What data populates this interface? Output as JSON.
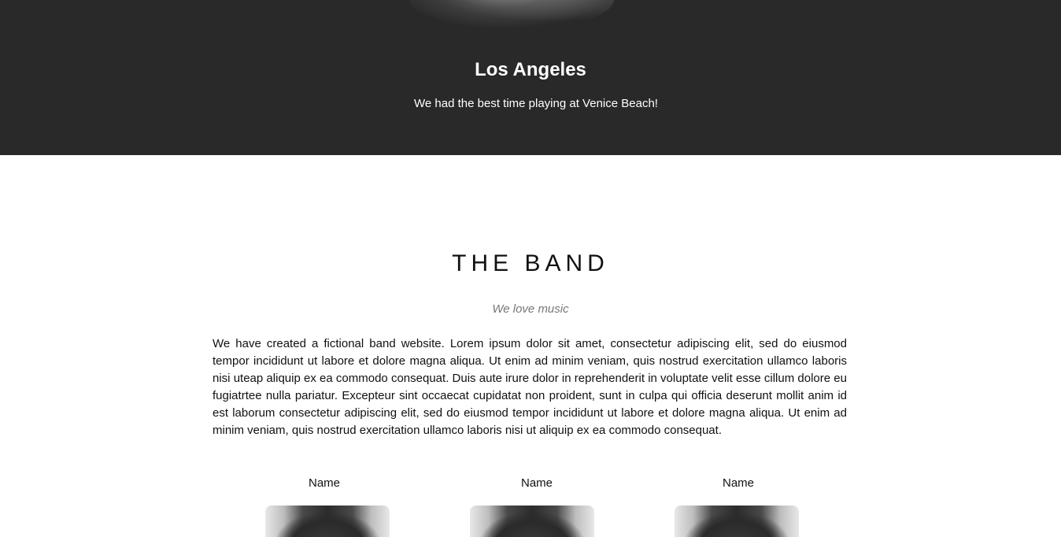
{
  "hero": {
    "title": "Los Angeles",
    "caption": "We had the best time playing at Venice Beach!"
  },
  "band": {
    "title": "THE BAND",
    "subtitle": "We love music",
    "body": "We have created a fictional band website. Lorem ipsum dolor sit amet, consectetur adipiscing elit, sed do eiusmod tempor incididunt ut labore et dolore magna aliqua. Ut enim ad minim veniam, quis nostrud exercitation ullamco laboris nisi uteap aliquip ex ea commodo consequat. Duis aute irure dolor in reprehenderit in voluptate velit esse cillum dolore eu fugiatrtee nulla pariatur. Excepteur sint occaecat cupidatat non proident, sunt in culpa qui officia deserunt mollit anim id est laborum consectetur adipiscing elit, sed do eiusmod tempor incididunt ut labore et dolore magna aliqua. Ut enim ad minim veniam, quis nostrud exercitation ullamco laboris nisi ut aliquip ex ea commodo consequat."
  },
  "members": [
    {
      "name": "Name"
    },
    {
      "name": "Name"
    },
    {
      "name": "Name"
    }
  ],
  "colors": {
    "hero_background": "#292929",
    "subtitle_text": "#777777"
  }
}
